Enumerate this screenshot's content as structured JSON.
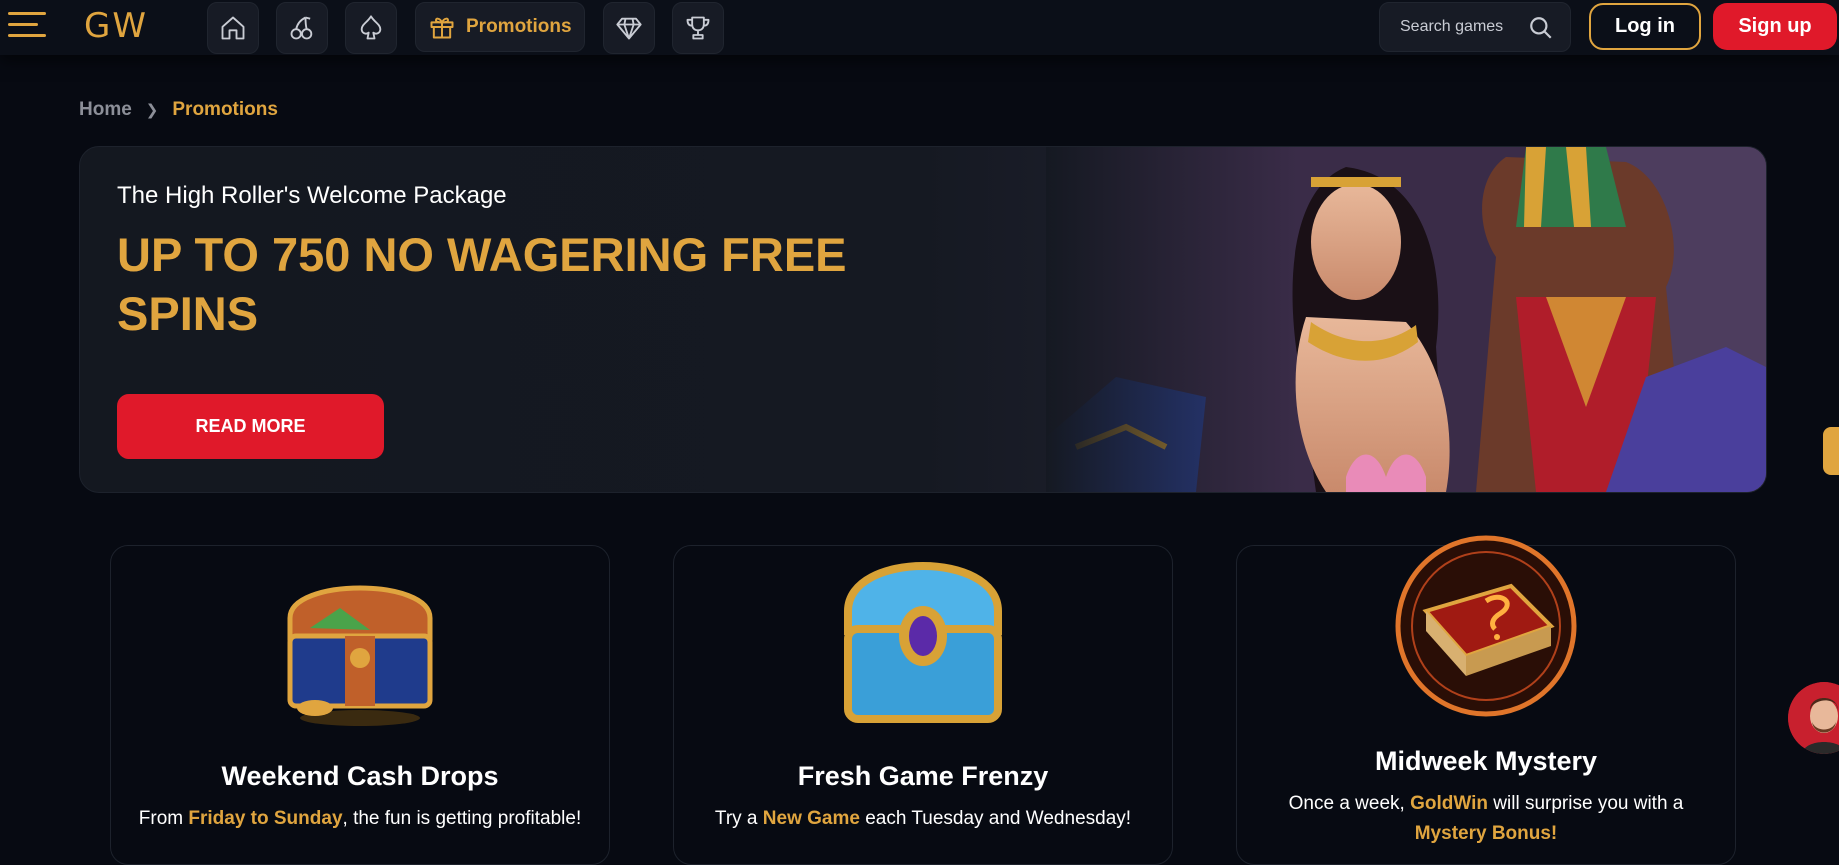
{
  "header": {
    "logo": "GW",
    "nav": [
      {
        "icon": "home-icon"
      },
      {
        "icon": "cherry-icon"
      },
      {
        "icon": "spade-icon"
      },
      {
        "icon": "gift-icon",
        "label": "Promotions"
      },
      {
        "icon": "diamond-icon"
      },
      {
        "icon": "trophy-icon"
      }
    ],
    "search_placeholder": "Search games",
    "login_label": "Log in",
    "signup_label": "Sign up"
  },
  "breadcrumb": {
    "home": "Home",
    "current": "Promotions"
  },
  "hero": {
    "subtitle": "The High Roller's Welcome Package",
    "title": "UP TO 750 NO WAGERING FREE SPINS",
    "button_label": "READ MORE"
  },
  "cards": [
    {
      "title": "Weekend Cash Drops",
      "text_pre": "From ",
      "text_hl": "Friday to Sunday",
      "text_post": ", the fun is getting profitable!",
      "icon": "treasure-chest-gold-icon"
    },
    {
      "title": "Fresh Game Frenzy",
      "text_pre": "Try a ",
      "text_hl": "New Game",
      "text_post": " each Tuesday and Wednesday!",
      "icon": "treasure-chest-blue-icon"
    },
    {
      "title": "Midweek Mystery",
      "text_pre": "Once a week, ",
      "text_hl": "GoldWin",
      "text_post": " will surprise you with a",
      "text_line2": "Mystery Bonus!",
      "icon": "mystery-book-icon"
    }
  ],
  "colors": {
    "accent": "#e0a53f",
    "primary_button": "#e0192a",
    "background": "#070a12"
  }
}
